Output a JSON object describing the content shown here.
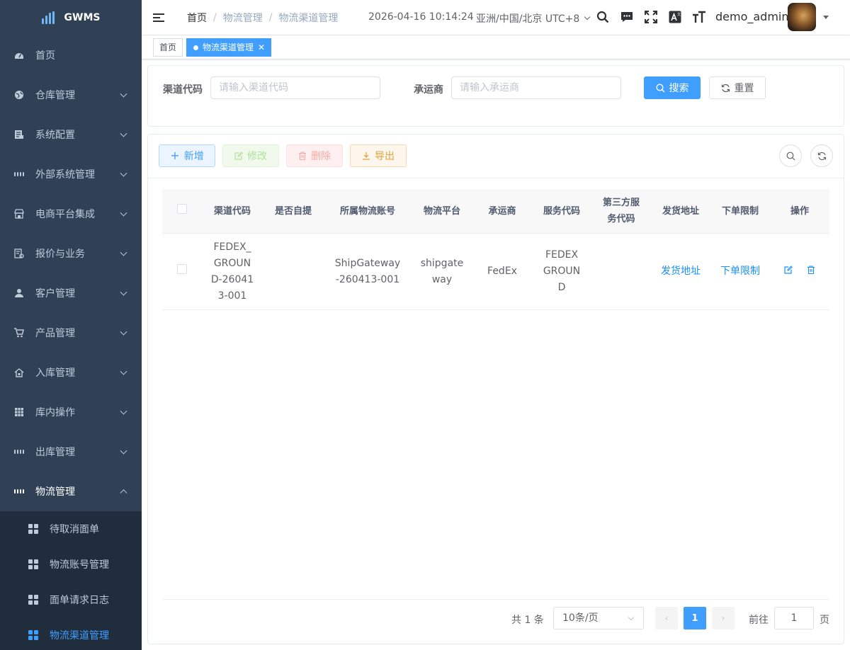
{
  "app": {
    "logo_text": "GWMS"
  },
  "sidebar": {
    "items": [
      {
        "label": "首页",
        "icon": "dashboard-icon"
      },
      {
        "label": "仓库管理",
        "icon": "globe-icon"
      },
      {
        "label": "系统配置",
        "icon": "document-icon"
      },
      {
        "label": "外部系统管理",
        "icon": "grid-icon"
      },
      {
        "label": "电商平台集成",
        "icon": "shop-icon"
      },
      {
        "label": "报价与业务",
        "icon": "report-icon"
      },
      {
        "label": "客户管理",
        "icon": "user-icon"
      },
      {
        "label": "产品管理",
        "icon": "cart-icon"
      },
      {
        "label": "入库管理",
        "icon": "home-icon"
      },
      {
        "label": "库内操作",
        "icon": "table-icon"
      },
      {
        "label": "出库管理",
        "icon": "grid-icon"
      },
      {
        "label": "物流管理",
        "icon": "grid-icon"
      }
    ],
    "submenu": [
      {
        "label": "待取消面单"
      },
      {
        "label": "物流账号管理"
      },
      {
        "label": "面单请求日志"
      },
      {
        "label": "物流渠道管理"
      }
    ]
  },
  "navbar": {
    "breadcrumb": [
      "首页",
      "物流管理",
      "物流渠道管理"
    ],
    "datetime": "2026-04-16 10:14:24",
    "timezone": "亚洲/中国/北京 UTC+8",
    "username": "demo_admin"
  },
  "tags": {
    "home": "首页",
    "active": "物流渠道管理"
  },
  "search": {
    "channel_code_label": "渠道代码",
    "channel_code_placeholder": "请输入渠道代码",
    "carrier_label": "承运商",
    "carrier_placeholder": "请输入承运商",
    "search_button": "搜索",
    "reset_button": "重置"
  },
  "toolbar": {
    "add": "新增",
    "edit": "修改",
    "delete": "删除",
    "export": "导出"
  },
  "table": {
    "columns": [
      "渠道代码",
      "是否自提",
      "所属物流账号",
      "物流平台",
      "承运商",
      "服务代码",
      "第三方服务代码",
      "发货地址",
      "下单限制",
      "操作"
    ],
    "rows": [
      {
        "channel_code": "FEDEX_GROUND-260413-001",
        "self_pickup": "",
        "account": "ShipGateway-260413-001",
        "platform": "shipgateway",
        "carrier": "FedEx",
        "service_code": "FEDEX GROUND",
        "third_party_code": "",
        "address_link": "发货地址",
        "limit_link": "下单限制"
      }
    ]
  },
  "pagination": {
    "total": "共 1 条",
    "page_size": "10条/页",
    "current": "1",
    "goto_label": "前往",
    "goto_value": "1",
    "page_suffix": "页"
  },
  "colors": {
    "sidebar_bg": "#304156",
    "submenu_bg": "#1f2d3d",
    "primary": "#409eff",
    "link": "#1890ff"
  }
}
